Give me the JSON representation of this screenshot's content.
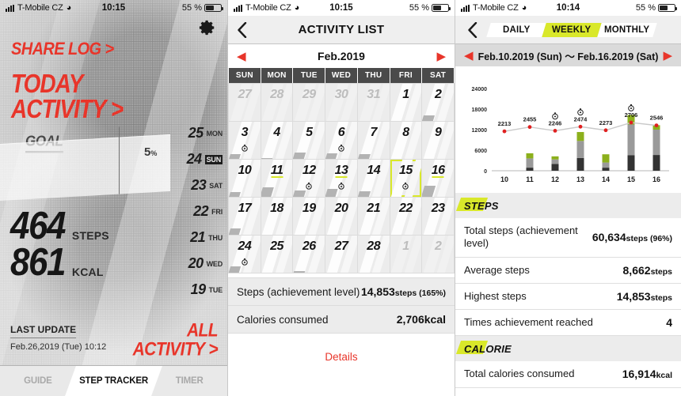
{
  "status_bar": {
    "carrier": "T-Mobile CZ",
    "wifi_icon": "wifi-icon",
    "time_p1": "10:15",
    "time_p2": "10:15",
    "time_p3": "10:14",
    "battery": "55 %"
  },
  "panel1": {
    "gear_icon": "gear-icon",
    "share_log": "SHARE LOG >",
    "today_activity_line1": "TODAY",
    "today_activity_line2": "ACTIVITY >",
    "goal_label": "GOAL",
    "goal_percent": "5",
    "goal_percent_unit": "%",
    "steps_value": "464",
    "steps_unit": "STEPS",
    "kcal_value": "861",
    "kcal_unit": "KCAL",
    "day_list": [
      {
        "num": "25",
        "dow": "MON",
        "selected": false
      },
      {
        "num": "24",
        "dow": "SUN",
        "selected": true
      },
      {
        "num": "23",
        "dow": "SAT",
        "selected": false
      },
      {
        "num": "22",
        "dow": "FRI",
        "selected": false
      },
      {
        "num": "21",
        "dow": "THU",
        "selected": false
      },
      {
        "num": "20",
        "dow": "WED",
        "selected": false
      },
      {
        "num": "19",
        "dow": "TUE",
        "selected": false
      }
    ],
    "last_update_title": "LAST UPDATE",
    "last_update_date": "Feb.26,2019 (Tue) 10:12",
    "all_activity_line1": "ALL",
    "all_activity_line2": "ACTIVITY >",
    "tabs": [
      {
        "label": "GUIDE",
        "active": false
      },
      {
        "label": "STEP TRACKER",
        "active": true
      },
      {
        "label": "TIMER",
        "active": false
      }
    ]
  },
  "panel2": {
    "back_icon": "chevron-left-icon",
    "title": "ACTIVITY LIST",
    "prev_icon": "arrow-left-icon",
    "next_icon": "arrow-right-icon",
    "month": "Feb.2019",
    "dow_headers": [
      "SUN",
      "MON",
      "TUE",
      "WED",
      "THU",
      "FRI",
      "SAT"
    ],
    "days": [
      {
        "n": "27",
        "dim": true,
        "fill": 0,
        "marker": false,
        "hl": false,
        "today": false
      },
      {
        "n": "28",
        "dim": true,
        "fill": 0,
        "marker": false,
        "hl": false,
        "today": false
      },
      {
        "n": "29",
        "dim": true,
        "fill": 0,
        "marker": false,
        "hl": false,
        "today": false
      },
      {
        "n": "30",
        "dim": true,
        "fill": 0,
        "marker": false,
        "hl": false,
        "today": false
      },
      {
        "n": "31",
        "dim": true,
        "fill": 0,
        "marker": false,
        "hl": false,
        "today": false
      },
      {
        "n": "1",
        "dim": false,
        "fill": 0,
        "marker": false,
        "hl": false,
        "today": false
      },
      {
        "n": "2",
        "dim": false,
        "fill": 14,
        "marker": false,
        "hl": false,
        "today": false
      },
      {
        "n": "3",
        "dim": false,
        "fill": 13,
        "marker": true,
        "hl": false,
        "today": false
      },
      {
        "n": "4",
        "dim": false,
        "fill": 3,
        "marker": false,
        "hl": false,
        "today": false
      },
      {
        "n": "5",
        "dim": false,
        "fill": 17,
        "marker": false,
        "hl": false,
        "today": false
      },
      {
        "n": "6",
        "dim": false,
        "fill": 15,
        "marker": true,
        "hl": false,
        "today": false
      },
      {
        "n": "7",
        "dim": false,
        "fill": 12,
        "marker": false,
        "hl": false,
        "today": false
      },
      {
        "n": "8",
        "dim": false,
        "fill": 0,
        "marker": false,
        "hl": false,
        "today": false
      },
      {
        "n": "9",
        "dim": false,
        "fill": 0,
        "marker": false,
        "hl": false,
        "today": false
      },
      {
        "n": "10",
        "dim": false,
        "fill": 13,
        "marker": false,
        "hl": false,
        "today": false
      },
      {
        "n": "11",
        "dim": false,
        "fill": 26,
        "marker": false,
        "hl": true,
        "today": false
      },
      {
        "n": "12",
        "dim": false,
        "fill": 18,
        "marker": true,
        "hl": false,
        "today": false
      },
      {
        "n": "13",
        "dim": false,
        "fill": 22,
        "marker": true,
        "hl": true,
        "today": false
      },
      {
        "n": "14",
        "dim": false,
        "fill": 14,
        "marker": false,
        "hl": false,
        "today": false
      },
      {
        "n": "15",
        "dim": false,
        "fill": 0,
        "marker": true,
        "hl": false,
        "today": true
      },
      {
        "n": "16",
        "dim": false,
        "fill": 30,
        "marker": false,
        "hl": true,
        "today": false
      },
      {
        "n": "17",
        "dim": false,
        "fill": 16,
        "marker": false,
        "hl": false,
        "today": false
      },
      {
        "n": "18",
        "dim": false,
        "fill": 0,
        "marker": false,
        "hl": false,
        "today": false
      },
      {
        "n": "19",
        "dim": false,
        "fill": 0,
        "marker": false,
        "hl": false,
        "today": false
      },
      {
        "n": "20",
        "dim": false,
        "fill": 0,
        "marker": false,
        "hl": false,
        "today": false
      },
      {
        "n": "21",
        "dim": false,
        "fill": 0,
        "marker": false,
        "hl": false,
        "today": false
      },
      {
        "n": "22",
        "dim": false,
        "fill": 0,
        "marker": false,
        "hl": false,
        "today": false
      },
      {
        "n": "23",
        "dim": false,
        "fill": 0,
        "marker": false,
        "hl": false,
        "today": false
      },
      {
        "n": "24",
        "dim": false,
        "fill": 16,
        "marker": true,
        "hl": false,
        "today": false
      },
      {
        "n": "25",
        "dim": false,
        "fill": 0,
        "marker": false,
        "hl": false,
        "today": false
      },
      {
        "n": "26",
        "dim": false,
        "fill": 4,
        "marker": false,
        "hl": false,
        "today": false
      },
      {
        "n": "27",
        "dim": false,
        "fill": 0,
        "marker": false,
        "hl": false,
        "today": false
      },
      {
        "n": "28",
        "dim": false,
        "fill": 0,
        "marker": false,
        "hl": false,
        "today": false
      },
      {
        "n": "1",
        "dim": true,
        "fill": 0,
        "marker": false,
        "hl": false,
        "today": false
      },
      {
        "n": "2",
        "dim": true,
        "fill": 0,
        "marker": false,
        "hl": false,
        "today": false
      }
    ],
    "steps_label": "Steps (achievement level)",
    "steps_value": "14,853",
    "steps_unit": "steps (165%)",
    "calories_label": "Calories consumed",
    "calories_value": "2,706",
    "calories_unit": "kcal",
    "details_link": "Details"
  },
  "panel3": {
    "back_icon": "chevron-left-icon",
    "segments": [
      {
        "label": "DAILY",
        "active": false
      },
      {
        "label": "WEEKLY",
        "active": true
      },
      {
        "label": "MONTHLY",
        "active": false
      }
    ],
    "prev_icon": "arrow-left-icon",
    "next_icon": "arrow-right-icon",
    "range": "Feb.10.2019 (Sun) ～ Feb.16.2019 (Sat)",
    "steps_section": "STEPS",
    "steps_rows": [
      {
        "label": "Total steps (achievement level)",
        "value": "60,634",
        "unit": "steps (96%)"
      },
      {
        "label": "Average steps",
        "value": "8,662",
        "unit": "steps"
      },
      {
        "label": "Highest steps",
        "value": "14,853",
        "unit": "steps"
      },
      {
        "label": "Times achievement reached",
        "value": "4",
        "unit": ""
      }
    ],
    "calorie_section": "CALORIE",
    "calorie_rows": [
      {
        "label": "Total calories consumed",
        "value": "16,914",
        "unit": "kcal"
      }
    ]
  },
  "chart_data": {
    "type": "bar",
    "title": "",
    "xlabel": "",
    "ylabel": "",
    "categories": [
      "10",
      "11",
      "12",
      "13",
      "14",
      "15",
      "16"
    ],
    "ylim": [
      0,
      24000
    ],
    "yticks": [
      0,
      6000,
      12000,
      18000,
      24000
    ],
    "grid": false,
    "legend_position": "none",
    "series": [
      {
        "name": "steps-lower",
        "color": "#333333",
        "values": [
          0,
          900,
          2000,
          3700,
          900,
          4500,
          4600
        ]
      },
      {
        "name": "steps-middle",
        "color": "#9a9a9a",
        "values": [
          0,
          2700,
          1300,
          5000,
          1500,
          9000,
          7400
        ]
      },
      {
        "name": "steps-upper",
        "color": "#8cb01c",
        "values": [
          0,
          1500,
          900,
          2600,
          2400,
          2800,
          1300
        ]
      }
    ],
    "line_series": {
      "name": "calories",
      "color": "#e02020",
      "values": [
        2213,
        2455,
        2246,
        2474,
        2273,
        2706,
        2546
      ],
      "labels": [
        "2213",
        "2455",
        "2246",
        "2474",
        "2273",
        "2706",
        "2546"
      ],
      "icon_points": [
        2,
        3,
        5
      ],
      "icon": "stopwatch-icon"
    }
  }
}
